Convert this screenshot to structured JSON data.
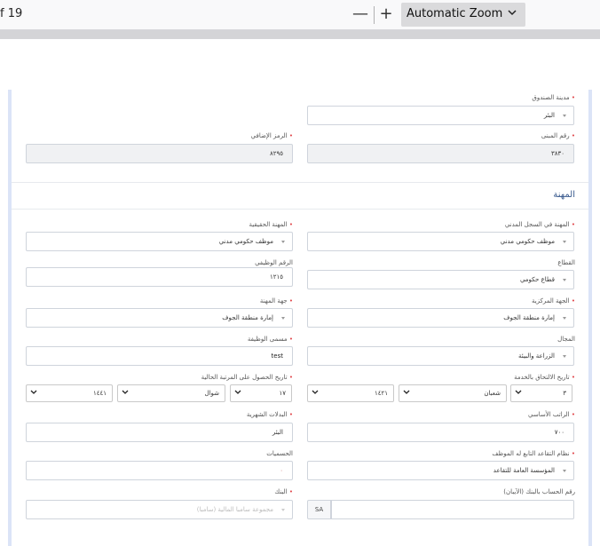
{
  "toolbar": {
    "page_of": "f 19",
    "zoom_out": "—",
    "zoom_in": "+",
    "zoom_value": "Automatic Zoom"
  },
  "form": {
    "fund_city": {
      "label": "مدينة الصندوق",
      "value": "البئر"
    },
    "building_no": {
      "label": "رقم المبنى",
      "value": "٣٨٣٠"
    },
    "extra_code": {
      "label": "الرمز الإضافي",
      "value": "٨٢٩٥"
    },
    "section_title": "المهنة",
    "civil_profession": {
      "label": "المهنة في السجل المدني",
      "value": "موظف حكومي مدني"
    },
    "actual_profession": {
      "label": "المهنة الحقيقية",
      "value": "موظف حكومي مدني"
    },
    "sector": {
      "label": "القطاع",
      "value": "قطاع حكومي"
    },
    "job_number": {
      "label": "الرقم الوظيفي",
      "value": "١٢١٥"
    },
    "central_entity": {
      "label": "الجهة المركزية",
      "value": "إمارة منطقة الجوف"
    },
    "work_entity": {
      "label": "جهة المهنة",
      "value": "إمارة منطقة الجوف"
    },
    "field": {
      "label": "المجال",
      "value": "الزراعة والبيئة"
    },
    "job_title": {
      "label": "مسمى الوظيفة",
      "value": "test"
    },
    "join_date": {
      "label": "تاريخ الالتحاق بالخدمة",
      "day": "٣",
      "month": "شعبان",
      "year": "١٤٢١"
    },
    "rank_date": {
      "label": "تاريخ الحصول على المرتبة الحالية",
      "day": "١٧",
      "month": "شوال",
      "year": "١٤٤١"
    },
    "basic_salary": {
      "label": "الراتب الأساسي",
      "value": "٧٠٠"
    },
    "monthly_allowances": {
      "label": "البدلات الشهرية",
      "value": "البئر"
    },
    "retirement_system": {
      "label": "نظام التقاعد التابع له الموظف",
      "value": "المؤسسة العامة للتقاعد"
    },
    "deductions": {
      "label": "الحسميات",
      "value": "٠"
    },
    "iban": {
      "label": "رقم الحساب بالبنك (الآيبان)",
      "prefix": "SA",
      "value": ""
    },
    "bank": {
      "label": "البنك",
      "value": "مجموعة سامبا المالية (سامبا)"
    }
  }
}
